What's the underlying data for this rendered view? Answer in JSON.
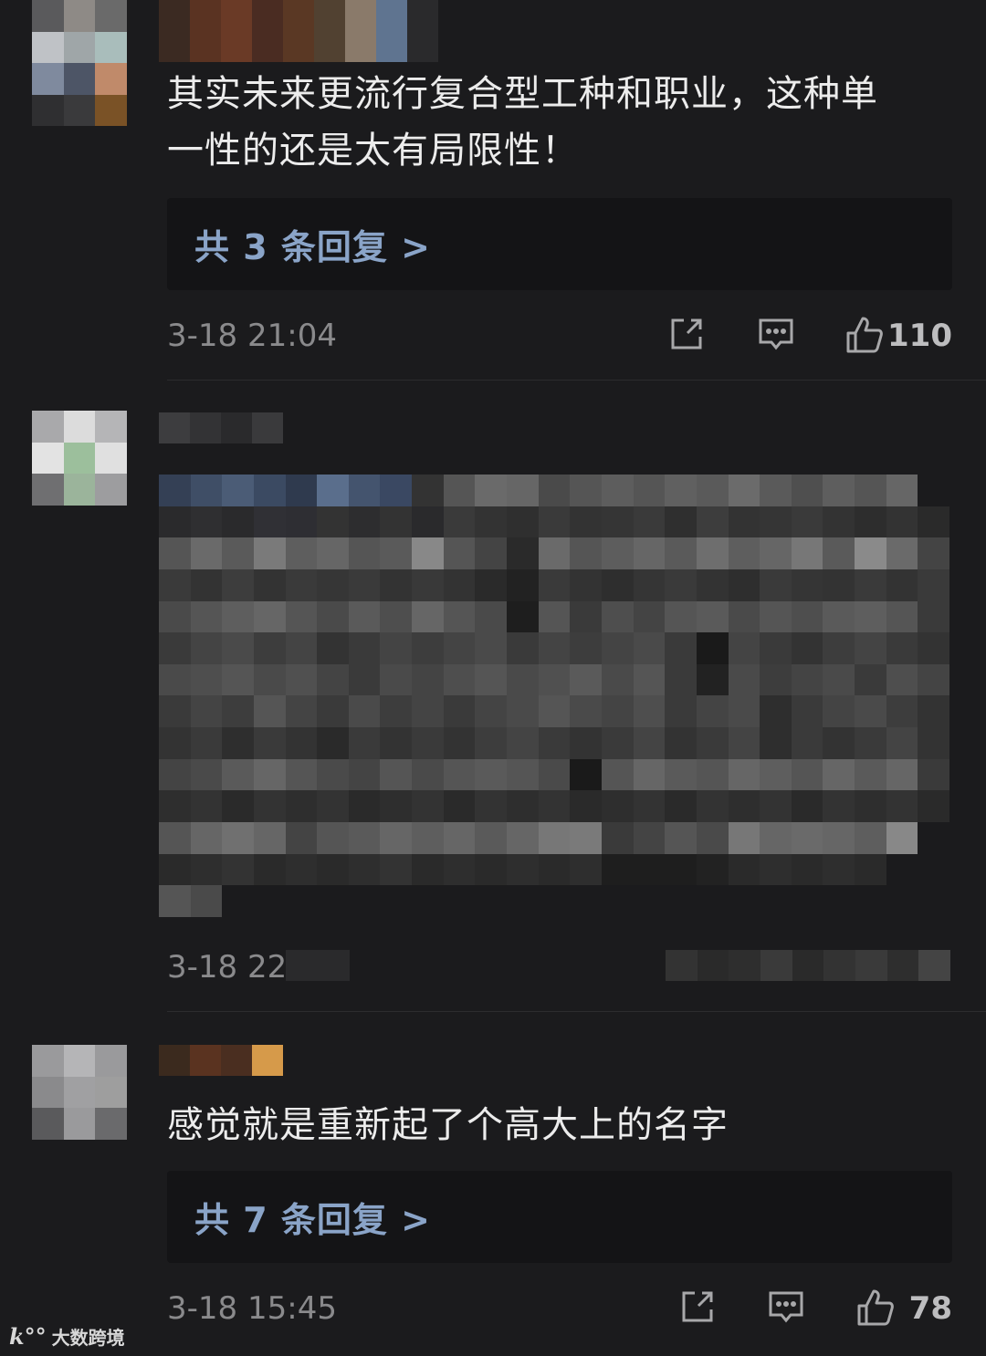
{
  "comments": [
    {
      "text_line1": "其实未来更流行复合型工种和职业，这种单",
      "text_line2": "一性的还是太有局限性！",
      "replies_label": "共 3 条回复 >",
      "time": "3-18 21:04",
      "likes": "110"
    },
    {
      "time": "3-18 22"
    },
    {
      "text_line1": "感觉就是重新起了个高大上的名字",
      "replies_label": "共 7 条回复 >",
      "time": "3-18 15:45",
      "likes": "78"
    }
  ],
  "watermark": {
    "logo": "k°°",
    "text": "大数跨境"
  },
  "icons": [
    "share-icon",
    "comment-icon",
    "thumbs-up-icon"
  ],
  "colors": {
    "background": "#1b1b1d",
    "reply_box": "#141416",
    "reply_link": "#8aa4c8",
    "timestamp": "#8a8a8c"
  }
}
